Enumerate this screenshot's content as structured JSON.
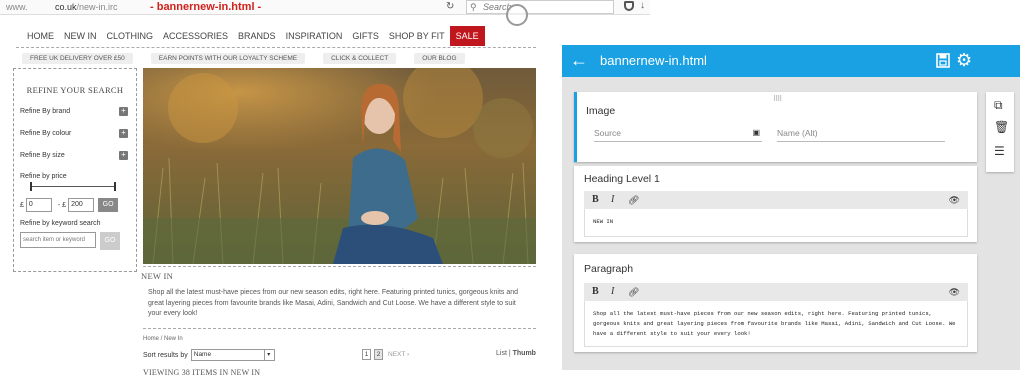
{
  "browser": {
    "url_prefix": "www.",
    "url_domain": "co.uk",
    "url_path": "/new-in.irc",
    "annotation": "- bannernew-in.html -",
    "reload_icon": "reload-icon",
    "search_placeholder": "Search"
  },
  "site": {
    "nav": [
      "HOME",
      "NEW IN",
      "CLOTHING",
      "ACCESSORIES",
      "BRANDS",
      "INSPIRATION",
      "GIFTS",
      "SHOP BY FIT",
      "SALE"
    ],
    "promos": [
      "FREE UK DELIVERY OVER £50",
      "EARN POINTS WITH OUR LOYALTY SCHEME",
      "CLICK & COLLECT",
      "OUR BLOG"
    ],
    "refine": {
      "title": "REFINE YOUR SEARCH",
      "brand": "Refine By brand",
      "colour": "Refine By colour",
      "size": "Refine By size",
      "price": "Refine by price",
      "currency": "£",
      "min": "0",
      "to": "- £",
      "max": "200",
      "go": "GO",
      "keyword_label": "Refine by keyword search",
      "keyword_placeholder": "search item or keyword",
      "keyword_go": "GO",
      "plus": "+"
    },
    "heading": "NEW IN",
    "body": "Shop all the latest must-have pieces from our new season edits, right here. Featuring printed tunics, gorgeous knits and great layering pieces from favourite brands like Masai, Adini, Sandwich and Cut Loose. We have a different style to suit your every look!",
    "breadcrumb": "Home / New In",
    "sort_label": "Sort results by",
    "sort_value": "Name",
    "pages": [
      "1",
      "2"
    ],
    "next": "NEXT ›",
    "view_list": "List",
    "view_sep": " | ",
    "view_thumb": "Thumb",
    "viewing": "VIEWING 38 ITEMS IN NEW IN"
  },
  "app": {
    "title": "bannernew-in.html",
    "accent": "#19a1e3",
    "image_block": {
      "title": "Image",
      "source_placeholder": "Source",
      "alt_placeholder": "Name (Alt)"
    },
    "heading_block": {
      "title": "Heading Level 1",
      "content": "NEW IN"
    },
    "paragraph_block": {
      "title": "Paragraph",
      "content": "Shop all the latest must-have pieces from our new season edits, right here. Featuring printed tunics, gorgeous knits and great layering pieces from favourite brands like Masai, Adini, Sandwich and Cut Loose. We have a different style to suit your every look!"
    },
    "toolbar": {
      "bold": "B",
      "italic": "I"
    }
  }
}
